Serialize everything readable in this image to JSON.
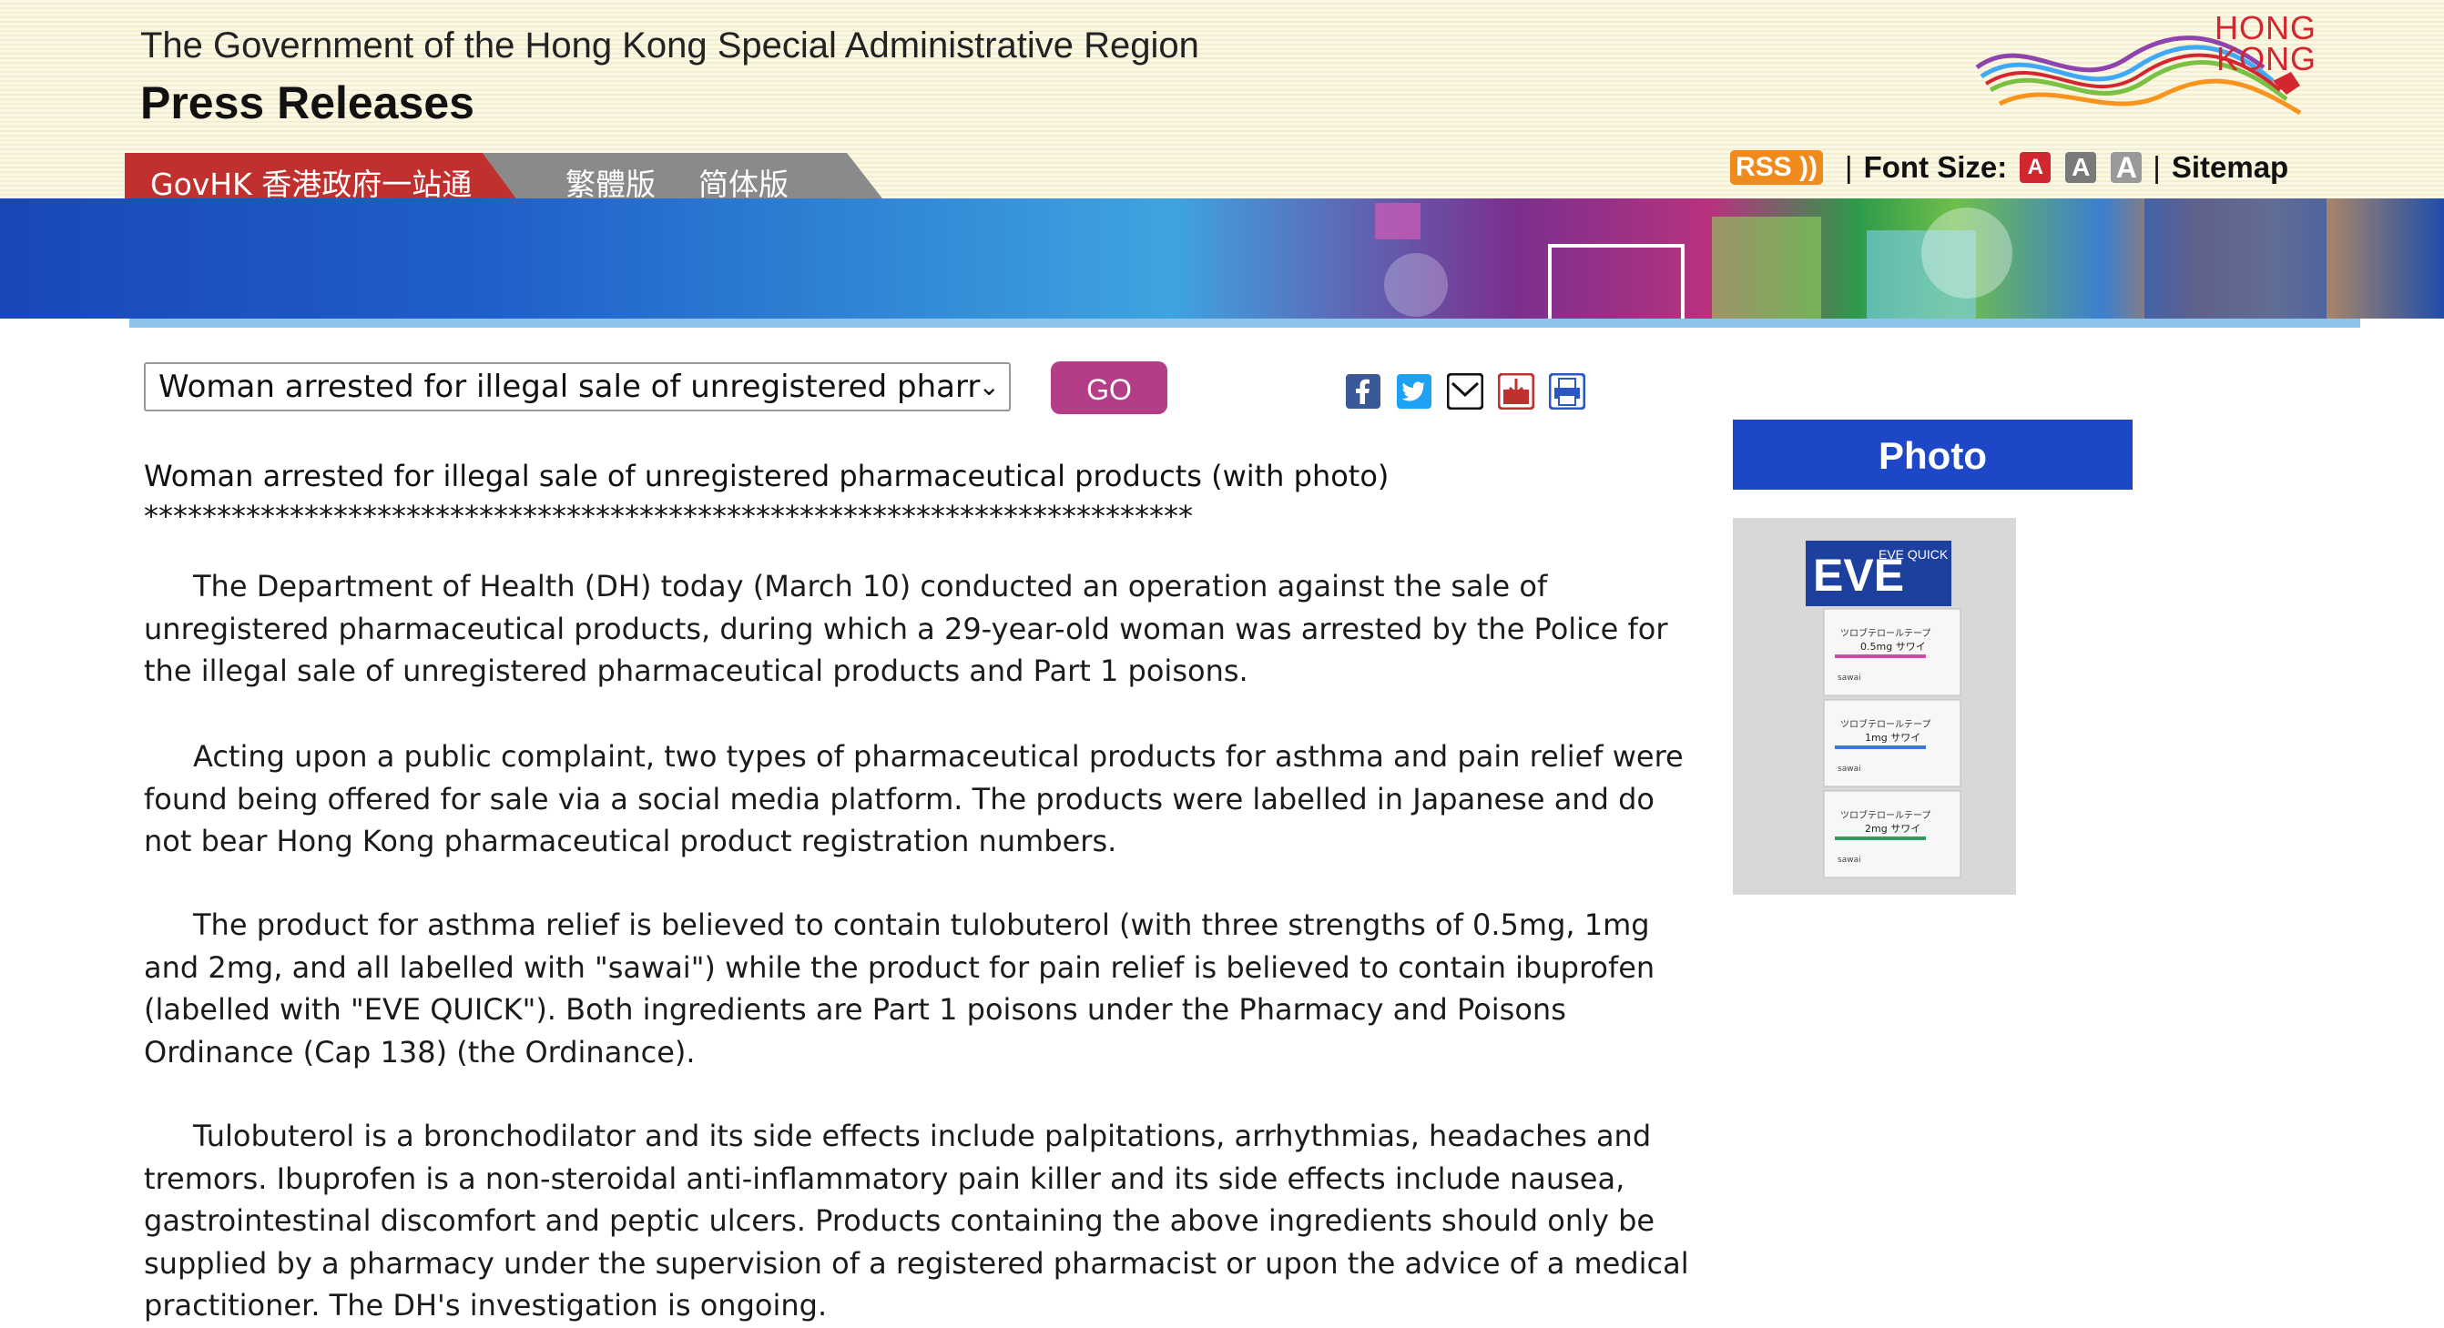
{
  "header": {
    "gov_title": "The Government of the Hong Kong Special Administrative Region",
    "press_title": "Press Releases",
    "logo_text": "HONG\nKONG",
    "lang_links": [
      "GovHK 香港政府一站通",
      "繁體版",
      "简体版"
    ],
    "rss_label": "RSS",
    "font_size_label": "Font Size:",
    "font_size_buttons": [
      "A",
      "A",
      "A"
    ],
    "sitemap_label": "Sitemap",
    "separator": "|"
  },
  "toolbar": {
    "select_value": "Woman arrested for illegal sale of unregistered pharr",
    "go_label": "GO",
    "share_icons": [
      "facebook-icon",
      "twitter-icon",
      "email-icon",
      "download-icon",
      "print-icon"
    ]
  },
  "article": {
    "title": "Woman arrested for illegal sale of unregistered pharmaceutical products (with photo)",
    "stars": "************************************************************************",
    "paragraphs": [
      "The Department of Health (DH) today (March 10) conducted an operation against the sale of unregistered pharmaceutical products, during which a 29-year-old woman was arrested by the Police for the illegal sale of unregistered pharmaceutical products and Part 1 poisons.",
      "Acting upon a public complaint, two types of pharmaceutical products for asthma and pain relief were found being offered for sale via a social media platform. The products were labelled in Japanese and do not bear Hong Kong pharmaceutical product registration numbers.",
      "The product for asthma relief is believed to contain tulobuterol (with three strengths of 0.5mg, 1mg and 2mg, and all labelled with \"sawai\") while the product for pain relief is believed to contain ibuprofen (labelled with \"EVE QUICK\"). Both ingredients are Part 1 poisons under the Pharmacy and Poisons Ordinance (Cap 138) (the Ordinance).",
      "Tulobuterol is a bronchodilator and its side effects include palpitations, arrhythmias, headaches and tremors. Ibuprofen is a non-steroidal anti-inflammatory pain killer and its side effects include nausea, gastrointestinal discomfort and peptic ulcers. Products containing the above ingredients should only be supplied by a pharmacy under the supervision of a registered pharmacist or upon the advice of a medical practitioner. The DH's investigation is ongoing."
    ]
  },
  "sidebar": {
    "photo_heading": "Photo",
    "photo_box_texts": [
      "EVE",
      "EVE QUICK",
      "ツロブテロールテープ",
      "0.5mg サワイ",
      "1mg サワイ",
      "2mg サワイ",
      "sawai"
    ]
  },
  "colors": {
    "go_button": "#b33d87",
    "photo_heading_bg": "#1e47c7",
    "govhk_tab": "#c0302e",
    "lang_tab": "#8a8a8a",
    "rss": "#f08a1c"
  }
}
